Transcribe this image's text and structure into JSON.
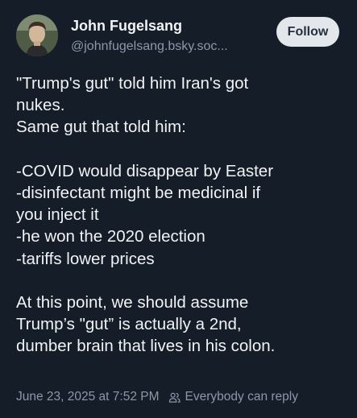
{
  "author": {
    "name": "John Fugelsang",
    "handle": "@johnfugelsang.bsky.soc..."
  },
  "follow_label": "Follow",
  "post": {
    "lines": [
      "\"Trump's gut\" told him Iran's got",
      "nukes.",
      "Same gut that told him:",
      "",
      "-COVID would disappear by Easter",
      "-disinfectant might be medicinal if",
      "you inject it",
      "-he won the 2020 election",
      "-tariffs lower prices",
      "",
      "At this point, we should assume",
      "Trump’s \"gut” is actually a 2nd,",
      "dumber brain that lives in his colon."
    ]
  },
  "meta": {
    "timestamp": "June 23, 2025 at 7:52 PM",
    "reply_setting": "Everybody can reply",
    "reply_icon": "people-icon"
  },
  "colors": {
    "background": "#151d28",
    "text": "#f1f3f5",
    "muted": "#8b98a9",
    "button_bg": "#e3e7ec",
    "button_text": "#26303d"
  }
}
